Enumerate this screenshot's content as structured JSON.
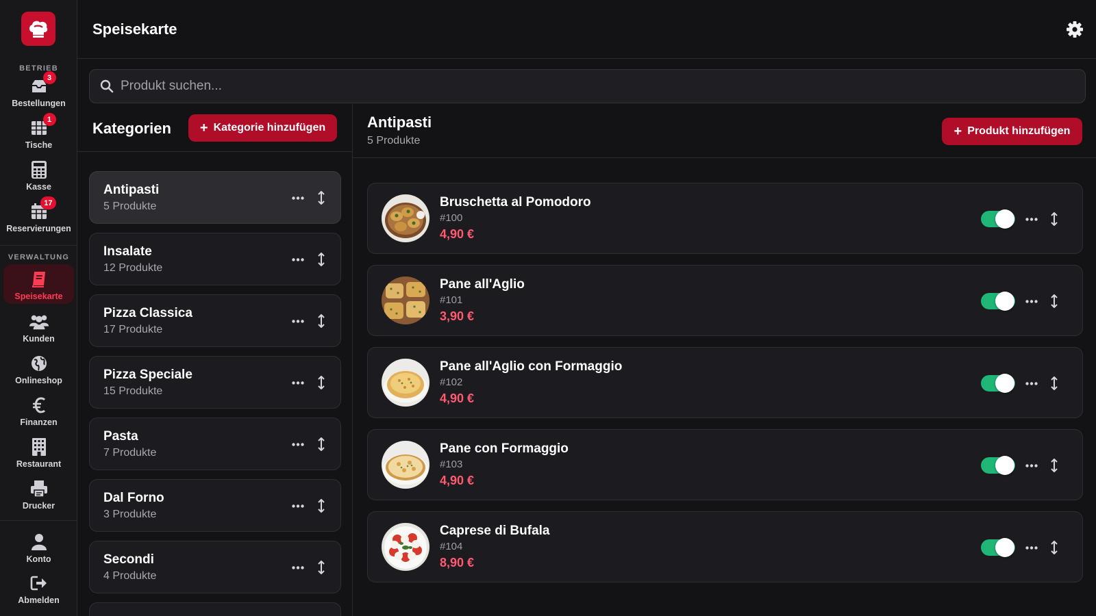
{
  "app": {
    "title": "Speisekarte"
  },
  "colors": {
    "accent": "#c8102e",
    "button": "#b00d29",
    "price": "#ff5a6e",
    "toggle_on": "#1fb676",
    "badge": "#e3102f"
  },
  "sidebar": {
    "sections": [
      {
        "label": "BETRIEB"
      },
      {
        "label": "VERWALTUNG"
      }
    ],
    "items": [
      {
        "label": "Bestellungen",
        "icon": "inbox-icon",
        "badge": "3"
      },
      {
        "label": "Tische",
        "icon": "table-grid-icon",
        "badge": "1"
      },
      {
        "label": "Kasse",
        "icon": "calculator-icon"
      },
      {
        "label": "Reservierungen",
        "icon": "calendar-icon",
        "badge": "17"
      },
      {
        "label": "Speisekarte",
        "icon": "menu-book-icon",
        "active": true
      },
      {
        "label": "Kunden",
        "icon": "users-icon"
      },
      {
        "label": "Onlineshop",
        "icon": "globe-icon"
      },
      {
        "label": "Finanzen",
        "icon": "euro-icon"
      },
      {
        "label": "Restaurant",
        "icon": "building-icon"
      },
      {
        "label": "Drucker",
        "icon": "printer-icon"
      },
      {
        "label": "Konto",
        "icon": "user-icon"
      },
      {
        "label": "Abmelden",
        "icon": "logout-icon"
      }
    ]
  },
  "search": {
    "placeholder": "Produkt suchen...",
    "value": ""
  },
  "categories": {
    "title": "Kategorien",
    "add_label": "Kategorie hinzufügen",
    "items": [
      {
        "name": "Antipasti",
        "count": "5 Produkte",
        "active": true
      },
      {
        "name": "Insalate",
        "count": "12 Produkte"
      },
      {
        "name": "Pizza Classica",
        "count": "17 Produkte"
      },
      {
        "name": "Pizza Speciale",
        "count": "15 Produkte"
      },
      {
        "name": "Pasta",
        "count": "7 Produkte"
      },
      {
        "name": "Dal Forno",
        "count": "3 Produkte"
      },
      {
        "name": "Secondi",
        "count": "4 Produkte"
      }
    ]
  },
  "products": {
    "title": "Antipasti",
    "count": "5 Produkte",
    "add_label": "Produkt hinzufügen",
    "items": [
      {
        "name": "Bruschetta al Pomodoro",
        "number": "#100",
        "price": "4,90 €",
        "enabled": true
      },
      {
        "name": "Pane all'Aglio",
        "number": "#101",
        "price": "3,90 €",
        "enabled": true
      },
      {
        "name": "Pane all'Aglio con Formaggio",
        "number": "#102",
        "price": "4,90 €",
        "enabled": true
      },
      {
        "name": "Pane con Formaggio",
        "number": "#103",
        "price": "4,90 €",
        "enabled": true
      },
      {
        "name": "Caprese di Bufala",
        "number": "#104",
        "price": "8,90 €",
        "enabled": true
      }
    ]
  }
}
